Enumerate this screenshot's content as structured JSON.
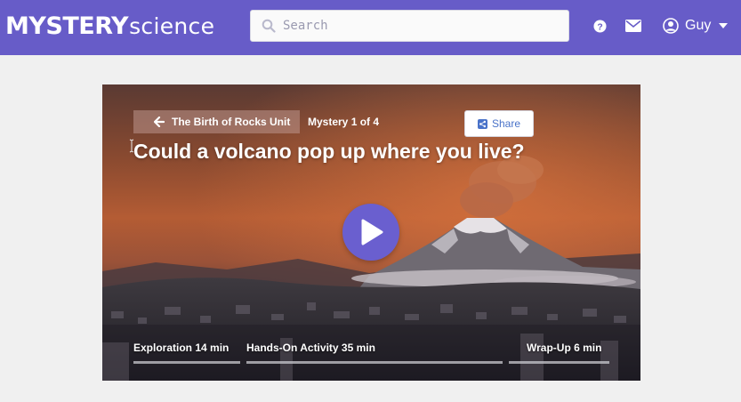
{
  "header": {
    "logo_bold": "MYSTERY",
    "logo_light": "science",
    "search_placeholder": "Search",
    "user_name": "Guy",
    "brand_color": "#675cc8",
    "icons": [
      "search-icon",
      "help-icon",
      "mail-icon",
      "user-icon",
      "caret-down-icon"
    ]
  },
  "hero": {
    "back_label": "The Birth of Rocks Unit",
    "mystery_count": "Mystery 1 of 4",
    "share_label": "Share",
    "title": "Could a volcano pop up where you live?",
    "play_color": "#6a5fcf",
    "segments": [
      {
        "name": "Exploration",
        "duration": "14 min"
      },
      {
        "name": "Hands-On Activity",
        "duration": "35 min"
      },
      {
        "name": "Wrap-Up",
        "duration": "6 min"
      }
    ]
  }
}
